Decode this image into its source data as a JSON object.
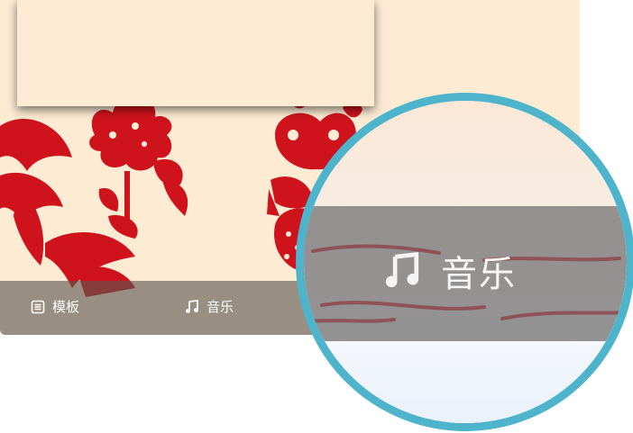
{
  "toolbar": {
    "template_label": "模板",
    "music_label": "音乐"
  },
  "magnifier": {
    "music_label": "音乐"
  },
  "colors": {
    "background": "#fdebd3",
    "papercut_red": "#d0141c",
    "toolbar": "#5a5550",
    "magnifier_ring": "#4db4cc"
  },
  "icons": [
    "template-icon",
    "music-note-icon"
  ]
}
